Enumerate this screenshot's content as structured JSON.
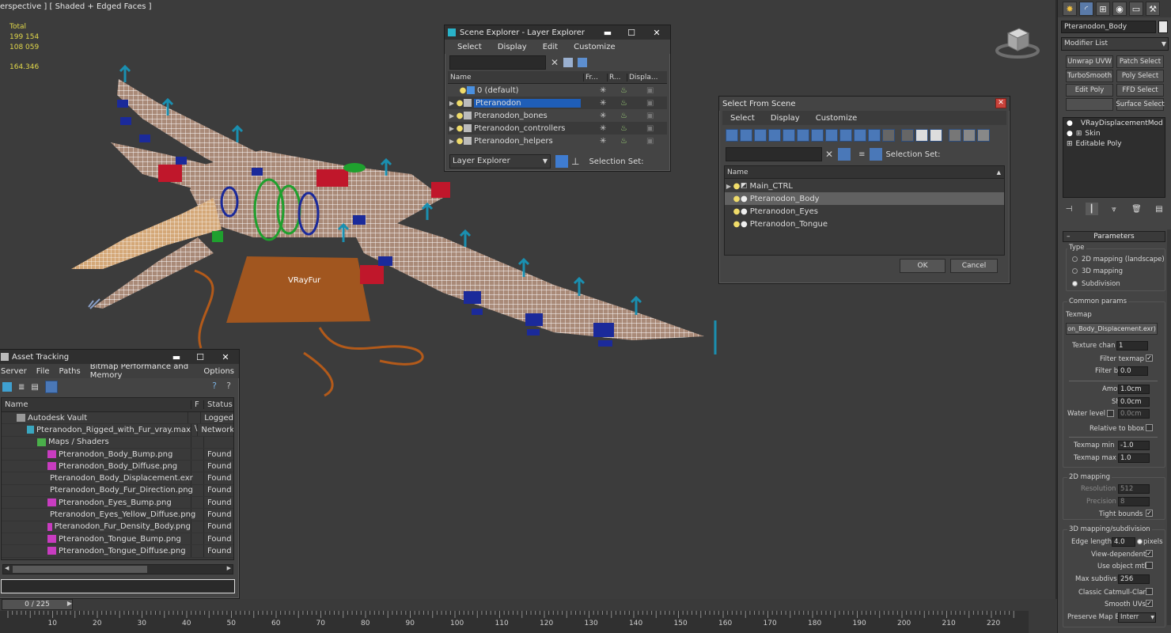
{
  "viewport": {
    "label": "erspective ] [ Shaded + Edged Faces ]",
    "stats": {
      "total_label": "Total",
      "polys": "199 154",
      "verts": "108 059",
      "fps": "164.346",
      "polys_prefix": "",
      "verts_prefix": ":"
    },
    "fur_label": "VRayFur"
  },
  "scene_explorer": {
    "title": "Scene Explorer - Layer Explorer",
    "menu": [
      "Select",
      "Display",
      "Edit",
      "Customize"
    ],
    "columns": [
      "Name",
      "Fr...",
      "R...",
      "Displa..."
    ],
    "layers": [
      {
        "name": "0 (default)",
        "selected": false
      },
      {
        "name": "Pteranodon",
        "selected": true
      },
      {
        "name": "Pteranodon_bones",
        "selected": false
      },
      {
        "name": "Pteranodon_controllers",
        "selected": false
      },
      {
        "name": "Pteranodon_helpers",
        "selected": false
      }
    ],
    "explorer_dropdown": "Layer Explorer",
    "selection_set_label": "Selection Set:"
  },
  "select_from_scene": {
    "title": "Select From Scene",
    "menu": [
      "Select",
      "Display",
      "Customize"
    ],
    "selection_set_label": "Selection Set:",
    "column": "Name",
    "items": [
      {
        "name": "Main_CTRL",
        "expandable": true,
        "highlighted": false
      },
      {
        "name": "Pteranodon_Body",
        "expandable": false,
        "highlighted": true
      },
      {
        "name": "Pteranodon_Eyes",
        "expandable": false,
        "highlighted": false
      },
      {
        "name": "Pteranodon_Tongue",
        "expandable": false,
        "highlighted": false
      }
    ],
    "ok_label": "OK",
    "cancel_label": "Cancel"
  },
  "asset_tracking": {
    "title": "Asset Tracking",
    "menu": [
      "Server",
      "File",
      "Paths",
      "Bitmap Performance and Memory",
      "Options"
    ],
    "columns": [
      "Name",
      "F",
      "Status"
    ],
    "rows": [
      {
        "name": "Autodesk Vault",
        "f": "",
        "status": "Logged",
        "indent": 1,
        "icon": "vault"
      },
      {
        "name": "Pteranodon_Rigged_with_Fur_vray.max",
        "f": "\\",
        "status": "Network",
        "indent": 2,
        "icon": "max"
      },
      {
        "name": "Maps / Shaders",
        "f": "",
        "status": "",
        "indent": 3,
        "icon": "maps"
      },
      {
        "name": "Pteranodon_Body_Bump.png",
        "f": "",
        "status": "Found",
        "indent": 4,
        "icon": "png"
      },
      {
        "name": "Pteranodon_Body_Diffuse.png",
        "f": "",
        "status": "Found",
        "indent": 4,
        "icon": "png"
      },
      {
        "name": "Pteranodon_Body_Displacement.exr",
        "f": "",
        "status": "Found",
        "indent": 4,
        "icon": "exr"
      },
      {
        "name": "Pteranodon_Body_Fur_Direction.png",
        "f": "",
        "status": "Found",
        "indent": 4,
        "icon": "png"
      },
      {
        "name": "Pteranodon_Eyes_Bump.png",
        "f": "",
        "status": "Found",
        "indent": 4,
        "icon": "png"
      },
      {
        "name": "Pteranodon_Eyes_Yellow_Diffuse.png",
        "f": "",
        "status": "Found",
        "indent": 4,
        "icon": "png"
      },
      {
        "name": "Pteranodon_Fur_Density_Body.png",
        "f": "",
        "status": "Found",
        "indent": 4,
        "icon": "png"
      },
      {
        "name": "Pteranodon_Tongue_Bump.png",
        "f": "",
        "status": "Found",
        "indent": 4,
        "icon": "png"
      },
      {
        "name": "Pteranodon_Tongue_Diffuse.png",
        "f": "",
        "status": "Found",
        "indent": 4,
        "icon": "png"
      }
    ]
  },
  "command_panel": {
    "object_name": "Pteranodon_Body",
    "modifier_list": "Modifier List",
    "modifier_buttons": [
      "Unwrap UVW",
      "Patch Select",
      "TurboSmooth",
      "Poly Select",
      "Edit Poly",
      "FFD Select",
      "",
      "Surface Select"
    ],
    "stack": [
      "VRayDisplacementMod",
      "Skin",
      "Editable Poly"
    ],
    "rollout_title": "Parameters",
    "type_label": "Type",
    "type_options": [
      "2D mapping (landscape)",
      "3D mapping",
      "Subdivision"
    ],
    "type_selected": 2,
    "common_params_label": "Common params",
    "texmap_label": "Texmap",
    "texmap_value": "on_Body_Displacement.exr)",
    "texture_chan_label": "Texture chan",
    "texture_chan_value": "1",
    "filter_texmap_label": "Filter texmap",
    "filter_blur_label": "Filter blur",
    "filter_blur_value": "0.0",
    "amount_label": "Amount",
    "amount_value": "1.0cm",
    "shift_label": "Shift",
    "shift_value": "0.0cm",
    "water_level_label": "Water level",
    "water_level_value": "0.0cm",
    "relative_bbox_label": "Relative to bbox",
    "texmap_min_label": "Texmap min",
    "texmap_min_value": "-1.0",
    "texmap_max_label": "Texmap max",
    "texmap_max_value": "1.0",
    "mapping2d_label": "2D mapping",
    "resolution_label": "Resolution",
    "resolution_value": "512",
    "precision_label": "Precision",
    "precision_value": "8",
    "tight_bounds_label": "Tight bounds",
    "mapping3d_label": "3D mapping/subdivision",
    "edge_length_label": "Edge length",
    "edge_length_value": "4.0",
    "pixels_label": "pixels",
    "view_dependent_label": "View-dependent",
    "use_object_mtl_label": "Use object mtl",
    "max_subdivs_label": "Max subdivs",
    "max_subdivs_value": "256",
    "classic_catmull_label": "Classic Catmull-Clark",
    "smooth_uvs_label": "Smooth UVs",
    "preserve_map_label": "Preserve Map Bnd",
    "preserve_map_value": "Interr"
  },
  "timeline": {
    "frame_display": "0 / 225",
    "ticks": [
      "10",
      "20",
      "30",
      "40",
      "50",
      "60",
      "70",
      "80",
      "90",
      "100",
      "110",
      "120",
      "130",
      "140",
      "150",
      "160",
      "170",
      "180",
      "190",
      "200",
      "210",
      "220"
    ]
  },
  "colors": {
    "selection_blue": "#1f5eb8",
    "stats_yellow": "#e2d84a",
    "fur_plane": "#b35a1a",
    "bone_blue": "#1b2a9a",
    "controller_red": "#c0172b",
    "controller_green": "#1fa02e",
    "arrow_teal": "#1a8fb0"
  }
}
